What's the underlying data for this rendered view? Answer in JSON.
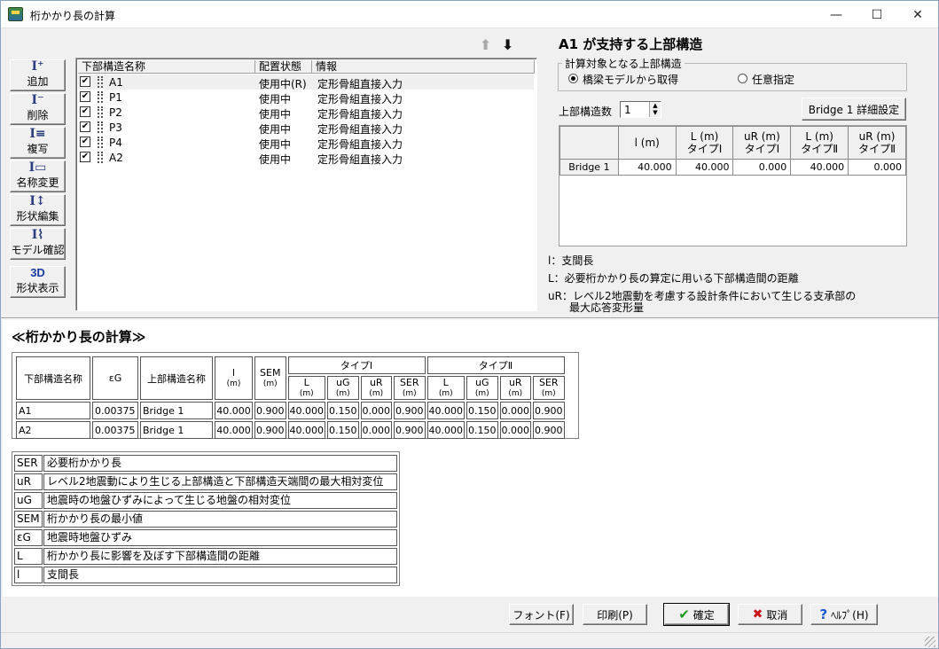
{
  "window": {
    "title": "桁かかり長の計算",
    "minimize_glyph": "—",
    "maximize_glyph": "☐",
    "close_glyph": "✕"
  },
  "toolbar": [
    {
      "label": "追加",
      "icon": "add-substructure-icon",
      "glyph": "I⁺"
    },
    {
      "label": "削除",
      "icon": "delete-substructure-icon",
      "glyph": "I⁻"
    },
    {
      "label": "複写",
      "icon": "copy-substructure-icon",
      "glyph": "I≡"
    },
    {
      "label": "名称変更",
      "icon": "rename-icon",
      "glyph": "I▭"
    },
    {
      "label": "形状編集",
      "icon": "shape-edit-icon",
      "glyph": "I↕"
    },
    {
      "label": "モデル確認",
      "icon": "model-check-icon",
      "glyph": "I⌇"
    },
    {
      "label": "形状表示",
      "icon": "3d-icon",
      "glyph": "3D"
    }
  ],
  "list": {
    "headers": [
      "下部構造名称",
      "配置状態",
      "情報"
    ],
    "up_arrow": "⬆",
    "down_arrow": "⬇",
    "rows": [
      {
        "name": "A1",
        "status": "使用中(R)",
        "info": "定形骨組直接入力",
        "checked": "✔"
      },
      {
        "name": "P1",
        "status": "使用中",
        "info": "定形骨組直接入力",
        "checked": "✔"
      },
      {
        "name": "P2",
        "status": "使用中",
        "info": "定形骨組直接入力",
        "checked": "✔"
      },
      {
        "name": "P3",
        "status": "使用中",
        "info": "定形骨組直接入力",
        "checked": "✔"
      },
      {
        "name": "P4",
        "status": "使用中",
        "info": "定形骨組直接入力",
        "checked": "✔"
      },
      {
        "name": "A2",
        "status": "使用中",
        "info": "定形骨組直接入力",
        "checked": "✔"
      }
    ]
  },
  "right": {
    "title": "A1 が支持する上部構造",
    "group_label": "計算対象となる上部構造",
    "radio1": "橋梁モデルから取得",
    "radio2": "任意指定",
    "count_label": "上部構造数",
    "count_value": "1",
    "spin_up": "▲",
    "spin_down": "▼",
    "detail_button": "Bridge 1 詳細設定",
    "grid_headers": [
      [
        "l (m)",
        ""
      ],
      [
        "L (m)",
        "タイプⅠ"
      ],
      [
        "uR (m)",
        "タイプⅠ"
      ],
      [
        "L (m)",
        "タイプⅡ"
      ],
      [
        "uR (m)",
        "タイプⅡ"
      ]
    ],
    "grid_row": {
      "name": "Bridge 1",
      "values": [
        "40.000",
        "40.000",
        "0.000",
        "40.000",
        "0.000"
      ]
    },
    "legend": [
      "l：支間長",
      "L：必要桁かかり長の算定に用いる下部構造間の距離",
      "uR：レベル2地震動を考慮する設計条件において生じる支承部の",
      "　　最大応答変形量"
    ]
  },
  "calc": {
    "title": "≪桁かかり長の計算≫",
    "h_sub": "下部構造名称",
    "h_eps": "εG",
    "h_sup": "上部構造名称",
    "h_l": "l",
    "h_l_unit": "(m)",
    "h_sem": "SEM",
    "h_sem_unit": "(m)",
    "h_type1": "タイプⅠ",
    "h_type2": "タイプⅡ",
    "sub_heads": [
      [
        "L",
        "(m)"
      ],
      [
        "uG",
        "(m)"
      ],
      [
        "uR",
        "(m)"
      ],
      [
        "SER",
        "(m)"
      ],
      [
        "L",
        "(m)"
      ],
      [
        "uG",
        "(m)"
      ],
      [
        "uR",
        "(m)"
      ],
      [
        "SER",
        "(m)"
      ]
    ],
    "rows": [
      {
        "sub": "A1",
        "eps": "0.00375",
        "sup": "Bridge 1",
        "vals": [
          "40.000",
          "0.900",
          "40.000",
          "0.150",
          "0.000",
          "0.900",
          "40.000",
          "0.150",
          "0.000",
          "0.900"
        ]
      },
      {
        "sub": "A2",
        "eps": "0.00375",
        "sup": "Bridge 1",
        "vals": [
          "40.000",
          "0.900",
          "40.000",
          "0.150",
          "0.000",
          "0.900",
          "40.000",
          "0.150",
          "0.000",
          "0.900"
        ]
      }
    ]
  },
  "symbols": [
    {
      "sym": "SER",
      "desc": "必要桁かかり長"
    },
    {
      "sym": "uR",
      "desc": "レベル2地震動により生じる上部構造と下部構造天端間の最大相対変位"
    },
    {
      "sym": "uG",
      "desc": "地震時の地盤ひずみによって生じる地盤の相対変位"
    },
    {
      "sym": "SEM",
      "desc": "桁かかり長の最小値"
    },
    {
      "sym": "εG",
      "desc": "地震時地盤ひずみ"
    },
    {
      "sym": "L",
      "desc": "桁かかり長に影響を及ぼす下部構造間の距離"
    },
    {
      "sym": "l",
      "desc": "支間長"
    }
  ],
  "buttons": {
    "font": "フォント(F)",
    "print": "印刷(P)",
    "ok": "確定",
    "ok_icon": "✔",
    "cancel": "取消",
    "cancel_icon": "✖",
    "help": "ﾍﾙﾌﾟ(H)",
    "help_icon": "?"
  }
}
